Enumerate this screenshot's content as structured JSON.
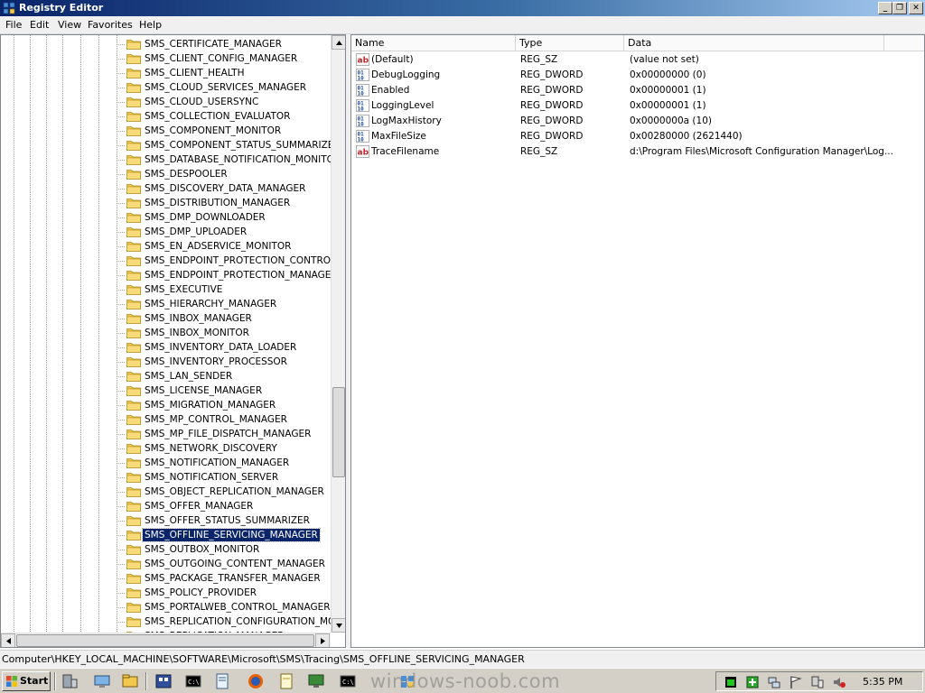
{
  "window": {
    "title": "Registry Editor"
  },
  "menu": [
    "File",
    "Edit",
    "View",
    "Favorites",
    "Help"
  ],
  "tree": {
    "items": [
      "SMS_CERTIFICATE_MANAGER",
      "SMS_CLIENT_CONFIG_MANAGER",
      "SMS_CLIENT_HEALTH",
      "SMS_CLOUD_SERVICES_MANAGER",
      "SMS_CLOUD_USERSYNC",
      "SMS_COLLECTION_EVALUATOR",
      "SMS_COMPONENT_MONITOR",
      "SMS_COMPONENT_STATUS_SUMMARIZER",
      "SMS_DATABASE_NOTIFICATION_MONITOR",
      "SMS_DESPOOLER",
      "SMS_DISCOVERY_DATA_MANAGER",
      "SMS_DISTRIBUTION_MANAGER",
      "SMS_DMP_DOWNLOADER",
      "SMS_DMP_UPLOADER",
      "SMS_EN_ADSERVICE_MONITOR",
      "SMS_ENDPOINT_PROTECTION_CONTROL_",
      "SMS_ENDPOINT_PROTECTION_MANAGER",
      "SMS_EXECUTIVE",
      "SMS_HIERARCHY_MANAGER",
      "SMS_INBOX_MANAGER",
      "SMS_INBOX_MONITOR",
      "SMS_INVENTORY_DATA_LOADER",
      "SMS_INVENTORY_PROCESSOR",
      "SMS_LAN_SENDER",
      "SMS_LICENSE_MANAGER",
      "SMS_MIGRATION_MANAGER",
      "SMS_MP_CONTROL_MANAGER",
      "SMS_MP_FILE_DISPATCH_MANAGER",
      "SMS_NETWORK_DISCOVERY",
      "SMS_NOTIFICATION_MANAGER",
      "SMS_NOTIFICATION_SERVER",
      "SMS_OBJECT_REPLICATION_MANAGER",
      "SMS_OFFER_MANAGER",
      "SMS_OFFER_STATUS_SUMMARIZER",
      "SMS_OFFLINE_SERVICING_MANAGER",
      "SMS_OUTBOX_MONITOR",
      "SMS_OUTGOING_CONTENT_MANAGER",
      "SMS_PACKAGE_TRANSFER_MANAGER",
      "SMS_POLICY_PROVIDER",
      "SMS_PORTALWEB_CONTROL_MANAGER",
      "SMS_REPLICATION_CONFIGURATION_MO",
      "SMS_REPLICATION_MANAGER"
    ],
    "selected": "SMS_OFFLINE_SERVICING_MANAGER"
  },
  "list": {
    "columns": [
      "Name",
      "Type",
      "Data"
    ],
    "rows": [
      {
        "name": "(Default)",
        "type": "REG_SZ",
        "data": "(value not set)",
        "icon": "string-value-icon"
      },
      {
        "name": "DebugLogging",
        "type": "REG_DWORD",
        "data": "0x00000000 (0)",
        "icon": "binary-value-icon"
      },
      {
        "name": "Enabled",
        "type": "REG_DWORD",
        "data": "0x00000001 (1)",
        "icon": "binary-value-icon"
      },
      {
        "name": "LoggingLevel",
        "type": "REG_DWORD",
        "data": "0x00000001 (1)",
        "icon": "binary-value-icon"
      },
      {
        "name": "LogMaxHistory",
        "type": "REG_DWORD",
        "data": "0x0000000a (10)",
        "icon": "binary-value-icon"
      },
      {
        "name": "MaxFileSize",
        "type": "REG_DWORD",
        "data": "0x00280000 (2621440)",
        "icon": "binary-value-icon"
      },
      {
        "name": "TraceFilename",
        "type": "REG_SZ",
        "data": "d:\\Program Files\\Microsoft Configuration Manager\\Log...",
        "icon": "string-value-icon"
      }
    ]
  },
  "statusbar": {
    "path": "Computer\\HKEY_LOCAL_MACHINE\\SOFTWARE\\Microsoft\\SMS\\Tracing\\SMS_OFFLINE_SERVICING_MANAGER"
  },
  "taskbar": {
    "start_label": "Start",
    "clock": "5:35 PM",
    "watermark": "windows-noob.com"
  },
  "colors": {
    "selection": "#0a246a",
    "folder": "#f2c94c",
    "titlebar": "#0a246a"
  }
}
